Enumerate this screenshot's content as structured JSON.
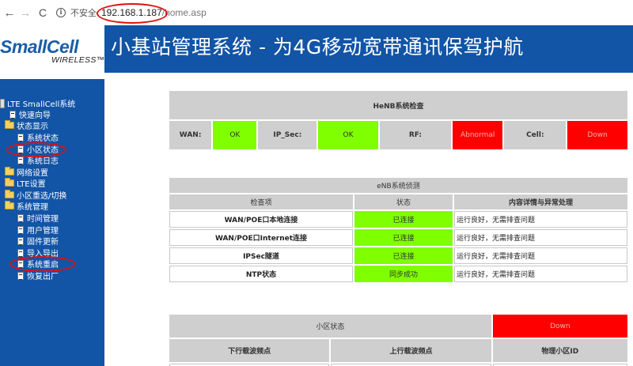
{
  "browser": {
    "back_icon": "←",
    "forward_icon": "→",
    "reload_icon": "C",
    "info_icon": "i",
    "not_secure": "不安全",
    "url_host": "192.168.1.187",
    "url_path": "/home.asp"
  },
  "header": {
    "logo_main": "SmallCell",
    "logo_sub": "WIRELESS™",
    "title": "小基站管理系统 - 为4G移动宽带通讯保驾护航"
  },
  "sidebar": {
    "root": "LTE SmallCell系统",
    "items": [
      {
        "label": "快速向导",
        "type": "page"
      },
      {
        "label": "状态显示",
        "type": "folder"
      },
      {
        "label": "系统状态",
        "type": "page"
      },
      {
        "label": "小区状态",
        "type": "page"
      },
      {
        "label": "系统日志",
        "type": "page"
      },
      {
        "label": "网络设置",
        "type": "folder"
      },
      {
        "label": "LTE设置",
        "type": "folder"
      },
      {
        "label": "小区重选/切换",
        "type": "folder"
      },
      {
        "label": "系统管理",
        "type": "folder"
      },
      {
        "label": "时间管理",
        "type": "page"
      },
      {
        "label": "用户管理",
        "type": "page"
      },
      {
        "label": "固件更新",
        "type": "page"
      },
      {
        "label": "导入导出",
        "type": "page"
      },
      {
        "label": "系统重启",
        "type": "page"
      },
      {
        "label": "恢复出厂",
        "type": "page"
      }
    ]
  },
  "henb": {
    "title": "HeNB系统检查",
    "cells": [
      {
        "label": "WAN:",
        "value": "OK",
        "status": "green"
      },
      {
        "label": "IP_Sec:",
        "value": "OK",
        "status": "green"
      },
      {
        "label": "RF:",
        "value": "Abnormal",
        "status": "red"
      },
      {
        "label": "Cell:",
        "value": "Down",
        "status": "red"
      }
    ]
  },
  "enb": {
    "title": "eNB系统侦测",
    "headers": [
      "检查项",
      "状态",
      "内容详情与异常处理"
    ],
    "rows": [
      {
        "item": "WAN/POE口本地连接",
        "status": "已连接",
        "detail": "运行良好，无需排查问题"
      },
      {
        "item": "WAN/POE口Internet连接",
        "status": "已连接",
        "detail": "运行良好，无需排查问题"
      },
      {
        "item": "IPSec隧道",
        "status": "已连接",
        "detail": "运行良好，无需排查问题"
      },
      {
        "item": "NTP状态",
        "status": "同步成功",
        "detail": "运行良好，无需排查问题"
      }
    ]
  },
  "cell": {
    "title": "小区状态",
    "status": "Down",
    "headers": [
      "下行载波频点",
      "上行载波频点",
      "物理小区ID"
    ]
  },
  "colors": {
    "banner_blue": "#1254a6",
    "ok_green": "#7fff00",
    "alert_red": "#ff0000",
    "header_gray": "#cfcfcf",
    "annotation_red": "#e01010"
  }
}
